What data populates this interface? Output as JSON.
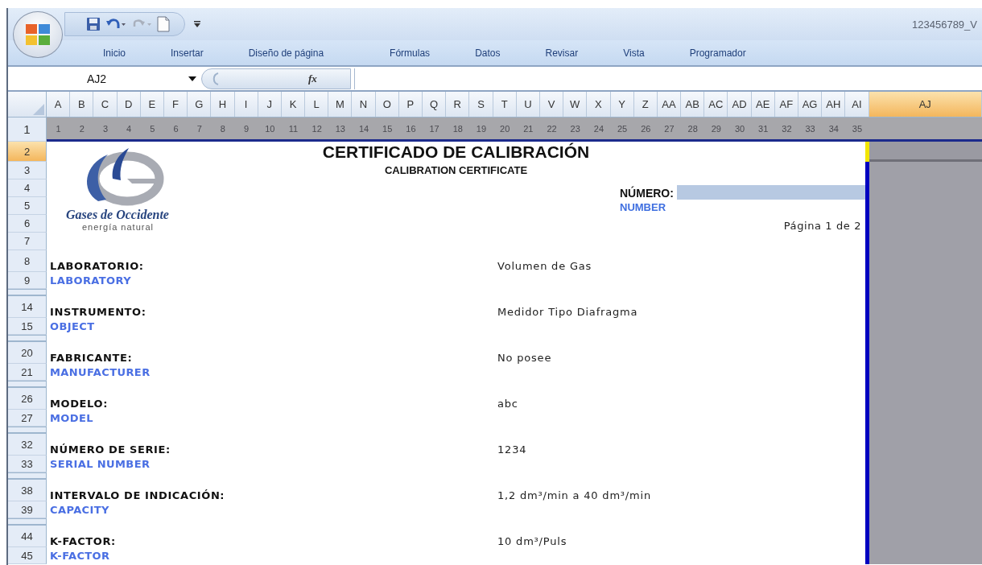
{
  "window": {
    "title": "123456789_V"
  },
  "quick_access": [
    {
      "kind": "save",
      "disabled": false
    },
    {
      "kind": "undo",
      "disabled": false
    },
    {
      "kind": "redo",
      "disabled": true
    },
    {
      "kind": "new",
      "disabled": false
    }
  ],
  "ribbon_tabs": [
    "Inicio",
    "Insertar",
    "Diseño de página",
    "Fórmulas",
    "Datos",
    "Revisar",
    "Vista",
    "Programador"
  ],
  "formula_bar": {
    "name_box": "AJ2",
    "function_label": "fx"
  },
  "columns": [
    {
      "label": "A",
      "selected": false
    },
    {
      "label": "B",
      "selected": false
    },
    {
      "label": "C",
      "selected": false
    },
    {
      "label": "D",
      "selected": false
    },
    {
      "label": "E",
      "selected": false
    },
    {
      "label": "F",
      "selected": false
    },
    {
      "label": "G",
      "selected": false
    },
    {
      "label": "H",
      "selected": false
    },
    {
      "label": "I",
      "selected": false
    },
    {
      "label": "J",
      "selected": false
    },
    {
      "label": "K",
      "selected": false
    },
    {
      "label": "L",
      "selected": false
    },
    {
      "label": "M",
      "selected": false
    },
    {
      "label": "N",
      "selected": false
    },
    {
      "label": "O",
      "selected": false
    },
    {
      "label": "P",
      "selected": false
    },
    {
      "label": "Q",
      "selected": false
    },
    {
      "label": "R",
      "selected": false
    },
    {
      "label": "S",
      "selected": false
    },
    {
      "label": "T",
      "selected": false
    },
    {
      "label": "U",
      "selected": false
    },
    {
      "label": "V",
      "selected": false
    },
    {
      "label": "W",
      "selected": false
    },
    {
      "label": "X",
      "selected": false
    },
    {
      "label": "Y",
      "selected": false
    },
    {
      "label": "Z",
      "selected": false
    },
    {
      "label": "AA",
      "selected": false
    },
    {
      "label": "AB",
      "selected": false
    },
    {
      "label": "AC",
      "selected": false
    },
    {
      "label": "AD",
      "selected": false
    },
    {
      "label": "AE",
      "selected": false
    },
    {
      "label": "AF",
      "selected": false
    },
    {
      "label": "AG",
      "selected": false
    },
    {
      "label": "AH",
      "selected": false
    },
    {
      "label": "AI",
      "selected": false
    },
    {
      "label": "AJ",
      "selected": true
    }
  ],
  "sheet": {
    "ruler": [
      "1",
      "2",
      "3",
      "4",
      "5",
      "6",
      "7",
      "8",
      "9",
      "10",
      "11",
      "12",
      "13",
      "14",
      "15",
      "16",
      "17",
      "18",
      "19",
      "20",
      "21",
      "22",
      "23",
      "24",
      "25",
      "26",
      "27",
      "28",
      "29",
      "30",
      "31",
      "32",
      "33",
      "34",
      "35"
    ],
    "rows": [
      {
        "number": "1",
        "kind": "ruler",
        "selected": false
      },
      {
        "number": "2",
        "kind": "title",
        "selected": true
      },
      {
        "number": "3",
        "kind": "normal",
        "selected": false
      },
      {
        "number": "4",
        "kind": "normal",
        "selected": false
      },
      {
        "number": "5",
        "kind": "normal",
        "selected": false
      },
      {
        "number": "6",
        "kind": "normal",
        "selected": false
      },
      {
        "number": "7",
        "kind": "normal",
        "selected": false
      },
      {
        "number": "8",
        "kind": "label",
        "selected": false
      },
      {
        "number": "9",
        "kind": "english",
        "selected": false
      },
      {
        "kind": "collapsed",
        "selected": false
      },
      {
        "number": "14",
        "kind": "label",
        "selected": false
      },
      {
        "number": "15",
        "kind": "english",
        "selected": false
      },
      {
        "kind": "collapsed",
        "selected": false
      },
      {
        "number": "20",
        "kind": "label",
        "selected": false
      },
      {
        "number": "21",
        "kind": "english",
        "selected": false
      },
      {
        "kind": "collapsed",
        "selected": false
      },
      {
        "number": "26",
        "kind": "label",
        "selected": false
      },
      {
        "number": "27",
        "kind": "english",
        "selected": false
      },
      {
        "kind": "collapsed",
        "selected": false
      },
      {
        "number": "32",
        "kind": "label",
        "selected": false
      },
      {
        "number": "33",
        "kind": "english",
        "selected": false
      },
      {
        "kind": "collapsed",
        "selected": false
      },
      {
        "number": "38",
        "kind": "label",
        "selected": false
      },
      {
        "number": "39",
        "kind": "english",
        "selected": false
      },
      {
        "kind": "collapsed",
        "selected": false
      },
      {
        "number": "44",
        "kind": "label",
        "selected": false
      },
      {
        "number": "45",
        "kind": "english",
        "selected": false
      }
    ]
  },
  "certificate": {
    "title": "CERTIFICADO DE CALIBRACIÓN",
    "subtitle": "CALIBRATION CERTIFICATE",
    "company": "Gases de Occidente",
    "tagline": "energía natural",
    "number_label": "NÚMERO:",
    "number_label_en": "NUMBER",
    "page": "Página 1 de 2",
    "fields": [
      {
        "label": "LABORATORIO:",
        "label_en": "LABORATORY",
        "value": "Volumen de Gas"
      },
      {
        "label": "INSTRUMENTO:",
        "label_en": "OBJECT",
        "value": "Medidor Tipo Diafragma"
      },
      {
        "label": "FABRICANTE:",
        "label_en": "MANUFACTURER",
        "value": "No posee"
      },
      {
        "label": "MODELO:",
        "label_en": "MODEL",
        "value": "abc"
      },
      {
        "label": "NÚMERO DE SERIE:",
        "label_en": "SERIAL NUMBER",
        "value": "1234"
      },
      {
        "label": "INTERVALO DE INDICACIÓN:",
        "label_en": "CAPACITY",
        "value": "1,2 dm³/min a 40 dm³/min"
      },
      {
        "label": "K-FACTOR:",
        "label_en": "K-FACTOR",
        "value": "10 dm³/Puls"
      }
    ]
  }
}
